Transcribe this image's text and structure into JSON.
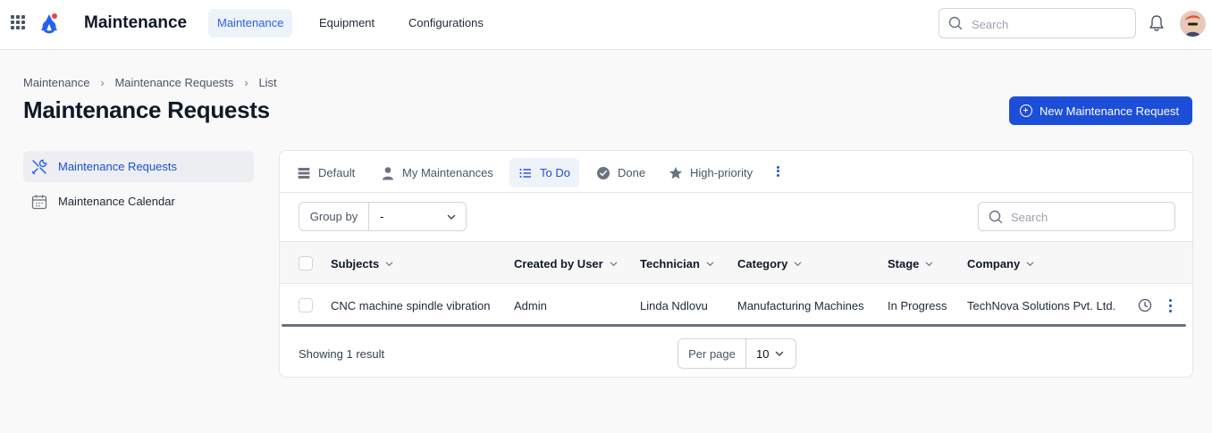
{
  "app": {
    "title": "Maintenance"
  },
  "nav": {
    "tabs": [
      {
        "label": "Maintenance",
        "active": true
      },
      {
        "label": "Equipment",
        "active": false
      },
      {
        "label": "Configurations",
        "active": false
      }
    ]
  },
  "top_search": {
    "placeholder": "Search",
    "icon": "search-icon"
  },
  "breadcrumb": [
    "Maintenance",
    "Maintenance Requests",
    "List"
  ],
  "page": {
    "title": "Maintenance Requests",
    "new_button_label": "New Maintenance Request"
  },
  "sidebar": {
    "items": [
      {
        "label": "Maintenance Requests",
        "icon": "tools-icon",
        "active": true
      },
      {
        "label": "Maintenance Calendar",
        "icon": "calendar-icon",
        "active": false
      }
    ]
  },
  "views": {
    "tabs": [
      {
        "label": "Default",
        "icon": "table-icon",
        "active": false
      },
      {
        "label": "My Maintenances",
        "icon": "user-icon",
        "active": false
      },
      {
        "label": "To Do",
        "icon": "list-icon",
        "active": true
      },
      {
        "label": "Done",
        "icon": "check-circle-icon",
        "active": false
      },
      {
        "label": "High-priority",
        "icon": "star-icon",
        "active": false
      }
    ]
  },
  "filters": {
    "group_by_label": "Group by",
    "group_by_value": "-",
    "search_placeholder": "Search"
  },
  "table": {
    "columns": [
      "Subjects",
      "Created by User",
      "Technician",
      "Category",
      "Stage",
      "Company"
    ],
    "rows": [
      [
        "CNC machine spindle vibration",
        "Admin",
        "Linda Ndlovu",
        "Manufacturing Machines",
        "In Progress",
        "TechNova Solutions Pvt. Ltd."
      ]
    ]
  },
  "footer": {
    "showing": "Showing 1 result",
    "per_page_label": "Per page",
    "per_page_value": "10"
  },
  "colors": {
    "accent": "#1d4ed8",
    "active_bg": "#eef2fa"
  }
}
